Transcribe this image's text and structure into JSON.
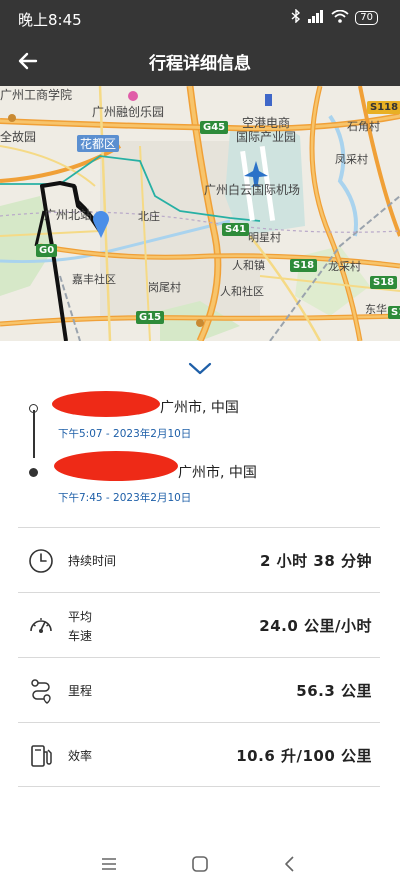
{
  "status_bar": {
    "time": "晚上8:45",
    "battery": "70",
    "icons": [
      "bluetooth-icon",
      "signal-icon",
      "wifi-icon",
      "battery-icon"
    ]
  },
  "header": {
    "title": "行程详细信息",
    "back_icon": "arrow-left-icon"
  },
  "map": {
    "labels": {
      "park": "广州融创乐园",
      "airport_zone_1": "空港电商",
      "airport_zone_2": "国际产业园",
      "district": "花都区",
      "airport": "广州白云国际机场",
      "station": "广州北站",
      "village1": "明星村",
      "village2": "北庄",
      "village3": "人和镇",
      "village4": "人和社区",
      "village5": "岗尾村",
      "village6": "嘉丰社区",
      "village7": "石角村",
      "village8": "凤采村",
      "village9": "东华",
      "village10": "龙采村",
      "left_top": "广州工商学院",
      "left_mid": "全故园"
    },
    "shields": [
      "S118",
      "G45",
      "S41",
      "S18",
      "S18",
      "G15",
      "G0",
      "S1"
    ],
    "route_color": "#111111",
    "marker_color": "#4a8ee8"
  },
  "trip": {
    "start": {
      "address_suffix": "广州市, 中国",
      "time": "下午5:07 - 2023年2月10日"
    },
    "end": {
      "address_suffix": "广州市, 中国",
      "time": "下午7:45 - 2023年2月10日"
    },
    "redaction_color": "#ee2a17"
  },
  "stats": [
    {
      "icon": "clock-icon",
      "label": "持续时间",
      "value": "2 小时 38 分钟"
    },
    {
      "icon": "speedometer-icon",
      "label_line1": "平均",
      "label_line2": "车速",
      "value": "24.0 公里/小时"
    },
    {
      "icon": "route-icon",
      "label": "里程",
      "value": "56.3 公里"
    },
    {
      "icon": "fuel-pump-icon",
      "label": "效率",
      "value": "10.6 升/100 公里"
    }
  ],
  "nav": {
    "menu_icon": "menu-icon",
    "home_icon": "home-square-icon",
    "back_icon": "back-triangle-icon"
  }
}
